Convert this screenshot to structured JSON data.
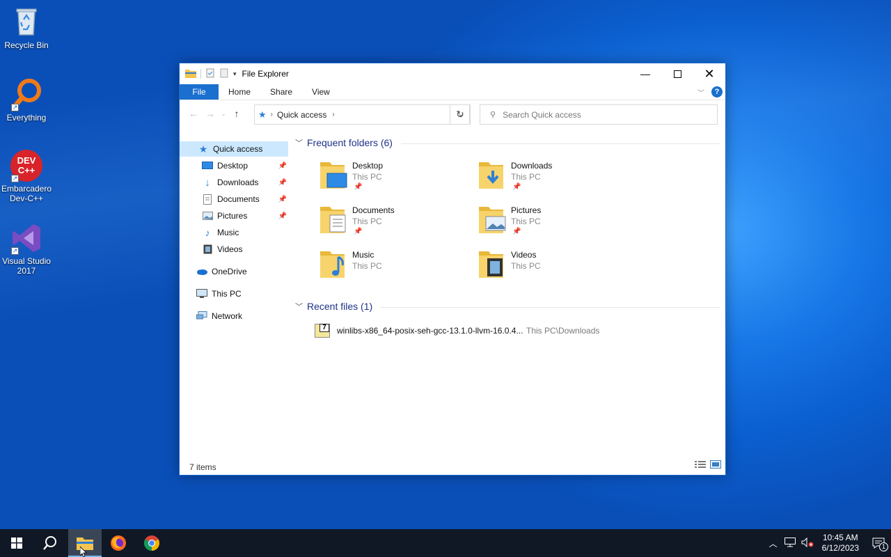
{
  "desktop": {
    "icons": [
      {
        "label": "Recycle Bin",
        "icon": "recycle-bin-icon"
      },
      {
        "label": "Everything",
        "icon": "everything-search-icon"
      },
      {
        "label": "Embarcadero Dev-C++",
        "icon": "devcpp-icon"
      },
      {
        "label": "Visual Studio 2017",
        "icon": "visual-studio-icon"
      }
    ],
    "devcpp_logo_text": "DEV C++"
  },
  "window": {
    "title": "File Explorer",
    "ribbon_tabs": [
      "File",
      "Home",
      "Share",
      "View"
    ],
    "help_label": "?",
    "address": {
      "crumb": "Quick access"
    },
    "search_placeholder": "Search Quick access",
    "nav": {
      "quick_access": "Quick access",
      "pinned": [
        {
          "label": "Desktop",
          "pinned": true
        },
        {
          "label": "Downloads",
          "pinned": true
        },
        {
          "label": "Documents",
          "pinned": true
        },
        {
          "label": "Pictures",
          "pinned": true
        },
        {
          "label": "Music",
          "pinned": false
        },
        {
          "label": "Videos",
          "pinned": false
        }
      ],
      "onedrive": "OneDrive",
      "this_pc": "This PC",
      "network": "Network"
    },
    "frequent": {
      "header": "Frequent folders (6)",
      "folders": [
        {
          "name": "Desktop",
          "location": "This PC",
          "pinned": true
        },
        {
          "name": "Downloads",
          "location": "This PC",
          "pinned": true
        },
        {
          "name": "Documents",
          "location": "This PC",
          "pinned": true
        },
        {
          "name": "Pictures",
          "location": "This PC",
          "pinned": true
        },
        {
          "name": "Music",
          "location": "This PC",
          "pinned": false
        },
        {
          "name": "Videos",
          "location": "This PC",
          "pinned": false
        }
      ]
    },
    "recent": {
      "header": "Recent files (1)",
      "files": [
        {
          "name": "winlibs-x86_64-posix-seh-gcc-13.1.0-llvm-16.0.4...",
          "path": "This PC\\Downloads",
          "icon_text": "7"
        }
      ]
    },
    "status": "7 items"
  },
  "taskbar": {
    "apps": [
      "start-icon",
      "search-icon",
      "file-explorer-icon",
      "firefox-icon",
      "chrome-icon"
    ],
    "clock": {
      "time": "10:45 AM",
      "date": "6/12/2023"
    },
    "notification_count": "1"
  },
  "colors": {
    "accent": "#1a6fcf",
    "selection": "#cce8ff",
    "folder": "#f3c44e",
    "group_header": "#1e3287"
  }
}
